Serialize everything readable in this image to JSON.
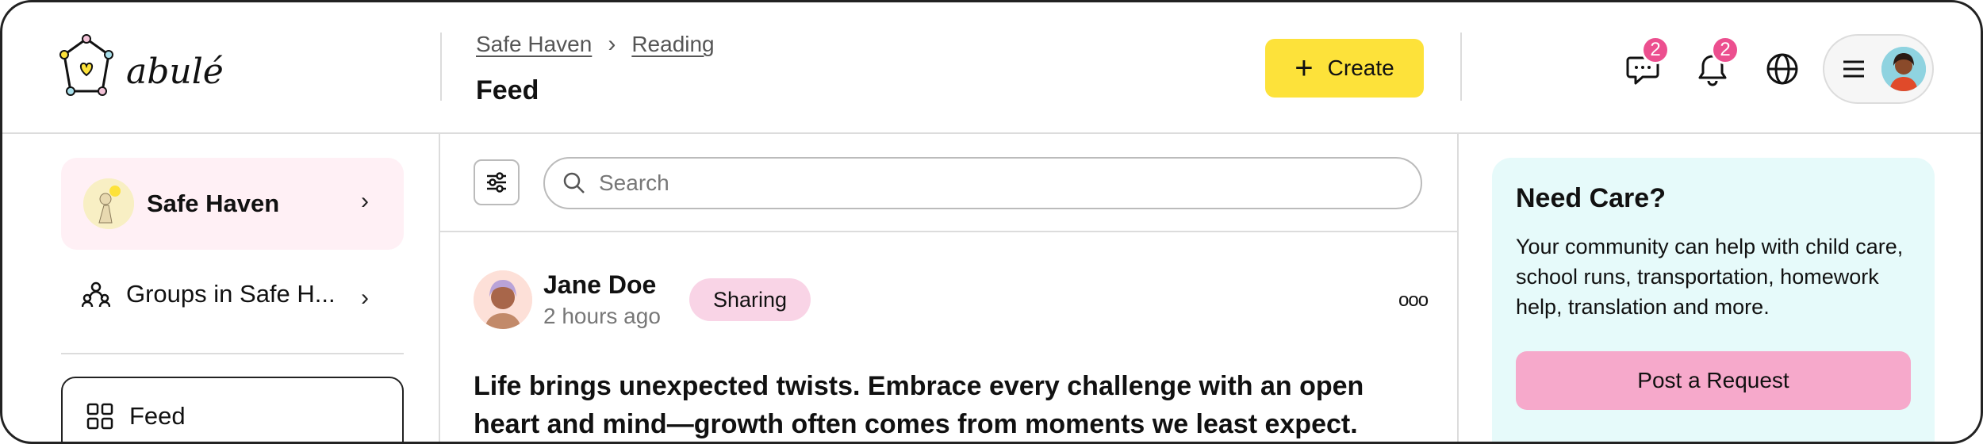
{
  "header": {
    "brand": "abulé",
    "breadcrumbs": [
      "Safe Haven",
      "Reading"
    ],
    "page_title": "Feed",
    "create_label": "Create",
    "messages_count": "2",
    "notifications_count": "2"
  },
  "sidebar": {
    "community": "Safe Haven",
    "groups_label": "Groups in Safe H...",
    "feed_label": "Feed"
  },
  "feed": {
    "search_placeholder": "Search",
    "post": {
      "author": "Jane Doe",
      "time": "2 hours ago",
      "tag": "Sharing",
      "text": "Life brings unexpected twists. Embrace every challenge with an open heart and mind—growth often comes from moments we least expect."
    }
  },
  "care": {
    "title": "Need Care?",
    "body": "Your community can help with child care, school runs, transportation, homework help, translation and more.",
    "button": "Post a Request"
  },
  "colors": {
    "accent_yellow": "#fde23a",
    "badge_pink": "#ec4f8f",
    "tag_pink": "#f9d4e6",
    "care_bg": "#e6fafa",
    "care_button": "#f6a9cb"
  }
}
